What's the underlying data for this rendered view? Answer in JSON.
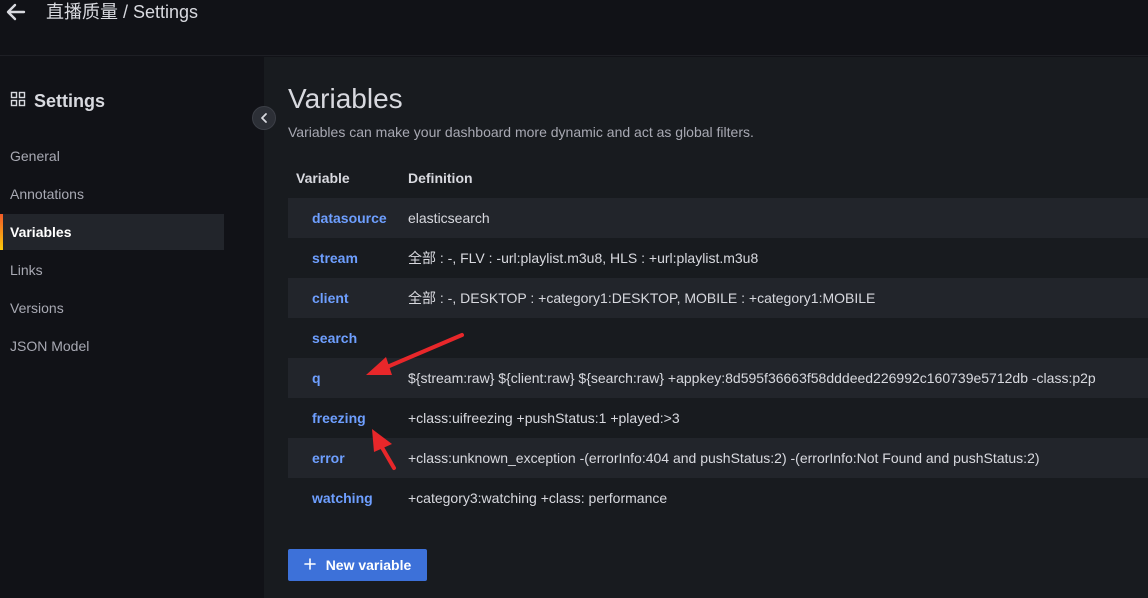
{
  "header": {
    "breadcrumb": "直播质量 / Settings"
  },
  "sidebar": {
    "title": "Settings",
    "items": [
      {
        "label": "General"
      },
      {
        "label": "Annotations"
      },
      {
        "label": "Variables",
        "active": true
      },
      {
        "label": "Links"
      },
      {
        "label": "Versions"
      },
      {
        "label": "JSON Model"
      }
    ]
  },
  "main": {
    "title": "Variables",
    "subtitle": "Variables can make your dashboard more dynamic and act as global filters.",
    "table": {
      "headers": [
        "Variable",
        "Definition"
      ],
      "rows": [
        {
          "name": "datasource",
          "definition": "elasticsearch"
        },
        {
          "name": "stream",
          "definition": "全部 : -, FLV : -url:playlist.m3u8, HLS : +url:playlist.m3u8"
        },
        {
          "name": "client",
          "definition": "全部 : -, DESKTOP : +category1:DESKTOP, MOBILE : +category1:MOBILE"
        },
        {
          "name": "search",
          "definition": ""
        },
        {
          "name": "q",
          "definition": "${stream:raw} ${client:raw} ${search:raw} +appkey:8d595f36663f58dddeed226992c160739e5712db -class:p2p"
        },
        {
          "name": "freezing",
          "definition": "+class:uifreezing +pushStatus:1 +played:>3"
        },
        {
          "name": "error",
          "definition": "+class:unknown_exception -(errorInfo:404 and pushStatus:2) -(errorInfo:Not Found and pushStatus:2)"
        },
        {
          "name": "watching",
          "definition": "+category3:watching +class: performance"
        }
      ]
    },
    "new_button": "New variable"
  },
  "colors": {
    "accent": "#3d71d9",
    "link": "#6e9fff",
    "annotation_arrow": "#e8272a"
  }
}
